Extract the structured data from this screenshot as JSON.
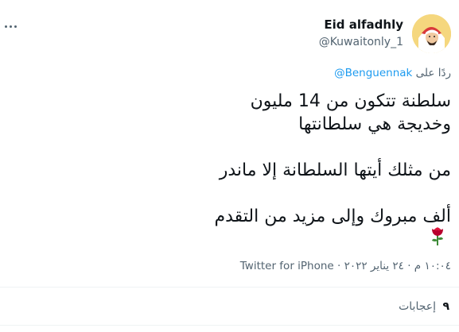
{
  "author": {
    "display_name": "Eid alfadhly",
    "handle": "@Kuwaitonly_1",
    "avatar_icon": "avatar-image"
  },
  "reply": {
    "prefix": "ردًا على",
    "mention": "@Benguennak"
  },
  "tweet": {
    "lines": [
      "سلطنة تتكون من 14 مليون",
      "وخديجة هي سلطانتها",
      "",
      "من مثلك أيتها السلطانة إلا ماندر",
      "",
      "ألف مبروك وإلى مزيد من التقدم"
    ],
    "emoji_icon": "rose-icon"
  },
  "meta": {
    "time": "١٠:٠٤ م",
    "separator": "·",
    "date": "٢٤ يناير ٢٠٢٢",
    "source": "Twitter for iPhone"
  },
  "stats": {
    "likes_count": "٩",
    "likes_label": "إعجابات"
  },
  "colors": {
    "accent": "#1d9bf0",
    "secondary_text": "#536471",
    "divider": "#eff3f4"
  }
}
